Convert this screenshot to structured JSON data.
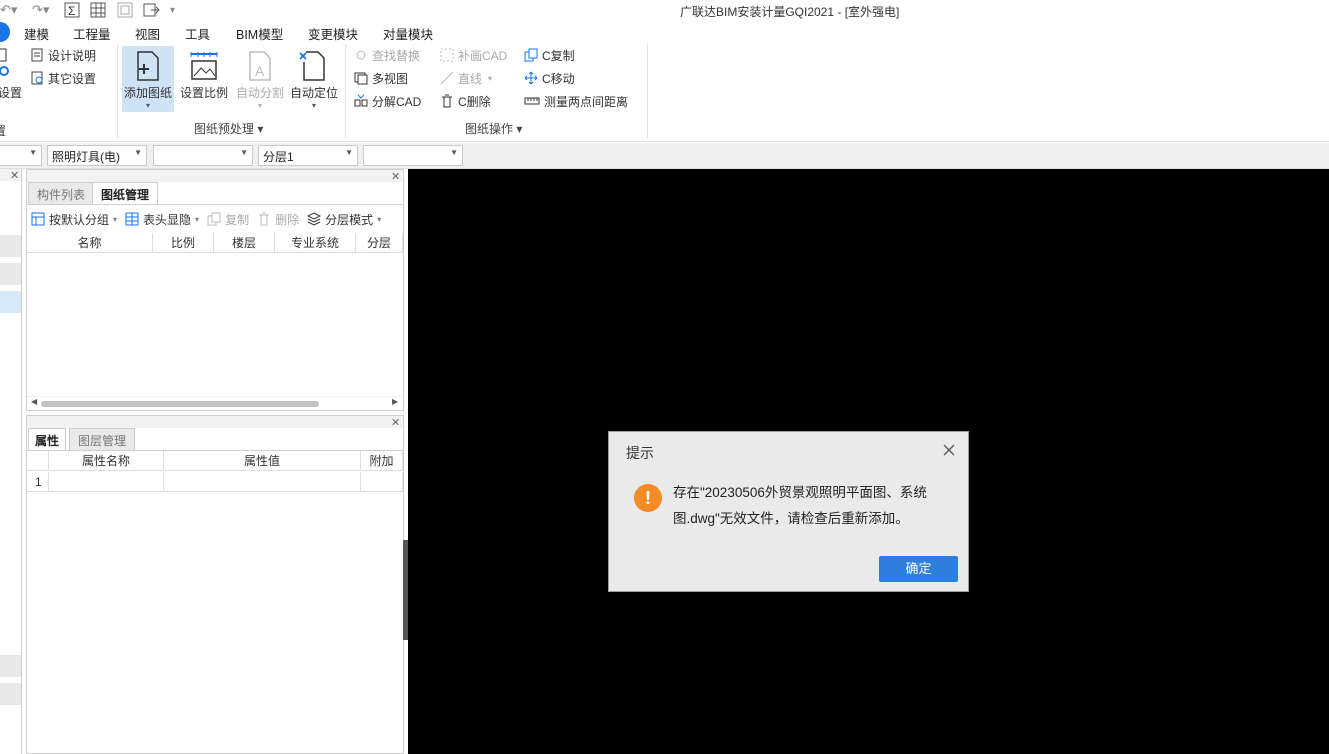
{
  "titlebar": {
    "title": "广联达BIM安装计量GQI2021 - [室外强电]",
    "qat_icons": [
      "undo-icon",
      "redo-icon",
      "sum-icon",
      "calculator-icon",
      "summary-icon",
      "export-icon",
      "more-icon"
    ]
  },
  "menu": {
    "items": [
      "建模",
      "工程量",
      "视图",
      "工具",
      "BIM模型",
      "变更模块",
      "对量模块"
    ]
  },
  "ribbon": {
    "left_cut": {
      "settings_label": "设置",
      "group_cut": "置"
    },
    "small_left": [
      "设计说明",
      "其它设置"
    ],
    "big_buttons": [
      {
        "label": "添加图纸",
        "selected": true
      },
      {
        "label": "设置比例",
        "selected": false
      },
      {
        "label": "自动分割",
        "disabled": true
      },
      {
        "label": "自动定位",
        "selected": false
      }
    ],
    "group_preprocess": "图纸预处理",
    "ops_col1": [
      {
        "label": "查找替换",
        "disabled": true
      },
      {
        "label": "多视图",
        "disabled": false
      },
      {
        "label": "分解CAD",
        "disabled": false
      }
    ],
    "ops_col2": [
      {
        "label": "补画CAD",
        "disabled": true
      },
      {
        "label": "直线",
        "disabled": true
      },
      {
        "label": "C删除",
        "disabled": false
      }
    ],
    "ops_col3": [
      {
        "label": "C复制",
        "disabled": false
      },
      {
        "label": "C移动",
        "disabled": false
      },
      {
        "label": "测量两点间距离",
        "disabled": false
      }
    ],
    "group_ops": "图纸操作"
  },
  "combos": [
    "",
    "照明灯具(电)",
    "",
    "分层1",
    ""
  ],
  "panel1": {
    "tabs": [
      "构件列表",
      "图纸管理"
    ],
    "toolbar": [
      {
        "label": "按默认分组",
        "disabled": false
      },
      {
        "label": "表头显隐",
        "disabled": false
      },
      {
        "label": "复制",
        "disabled": true
      },
      {
        "label": "删除",
        "disabled": true
      },
      {
        "label": "分层模式",
        "disabled": false
      }
    ],
    "columns": [
      "名称",
      "比例",
      "楼层",
      "专业系统",
      "分层"
    ]
  },
  "panel2": {
    "tabs": [
      "属性",
      "图层管理"
    ],
    "columns": [
      "属性名称",
      "属性值",
      "附加"
    ],
    "rows": [
      {
        "index": "1",
        "name": "",
        "value": "",
        "extra": ""
      }
    ]
  },
  "dialog": {
    "title": "提示",
    "message": "存在\"20230506外贸景观照明平面图、系统图.dwg\"无效文件，请检查后重新添加。",
    "ok_label": "确定"
  }
}
